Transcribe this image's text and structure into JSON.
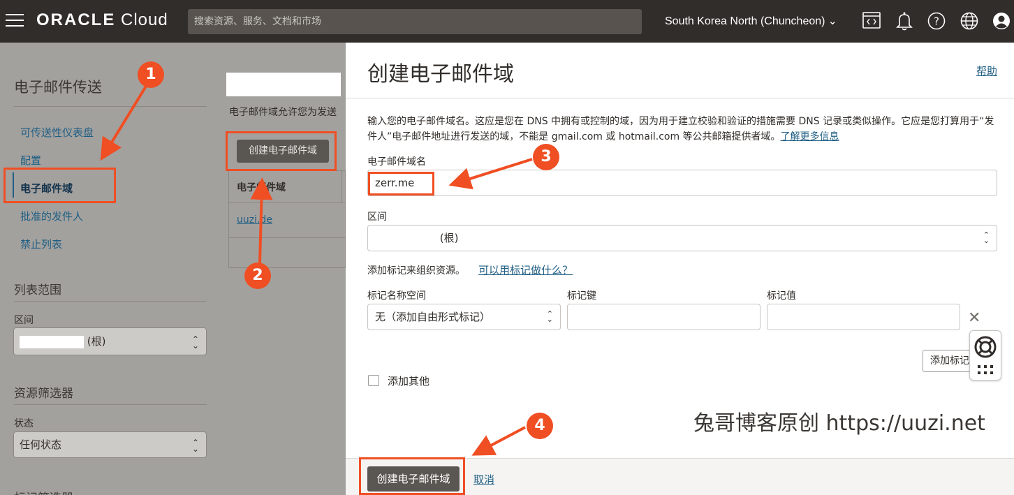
{
  "topbar": {
    "logo_brand": "ORACLE",
    "logo_product": "Cloud",
    "search_placeholder": "搜索资源、服务、文档和市场",
    "region": "South Korea North (Chuncheon)",
    "icons": [
      "hamburger-icon",
      "cloud-shell-icon",
      "bell-icon",
      "help-icon",
      "globe-icon",
      "user-icon"
    ]
  },
  "leftnav": {
    "title": "电子邮件传送",
    "items": [
      {
        "label": "可传送性仪表盘"
      },
      {
        "label": "配置"
      },
      {
        "label": "电子邮件域",
        "active": true
      },
      {
        "label": "批准的发件人"
      },
      {
        "label": "禁止列表"
      }
    ],
    "scope_title": "列表范围",
    "compartment_label": "区间",
    "compartment_value": "(根)",
    "filters_title": "资源筛选器",
    "state_label": "状态",
    "state_value": "任何状态",
    "tag_filters_title": "标记筛选器"
  },
  "middle": {
    "desc": "电子邮件域允许您为发送",
    "create_button": "创建电子邮件域",
    "column_header": "电子邮件域",
    "row_link": "uuzi.de"
  },
  "panel": {
    "title": "创建电子邮件域",
    "help": "帮助",
    "intro": "输入您的电子邮件域名。这应是您在 DNS 中拥有或控制的域，因为用于建立校验和验证的措施需要 DNS 记录或类似操作。它应是您打算用于“发件人”电子邮件地址进行发送的域，不能是 gmail.com 或 hotmail.com 等公共邮箱提供者域。",
    "intro_link": "了解更多信息",
    "domain_label": "电子邮件域名",
    "domain_value": "zerr.me",
    "compartment_label": "区间",
    "compartment_value": "(根)",
    "tags_intro": "添加标记来组织资源。",
    "tags_link": "可以用标记做什么？",
    "tag_ns_label": "标记名称空间",
    "tag_ns_value": "无（添加自由形式标记）",
    "tag_key_label": "标记键",
    "tag_value_label": "标记值",
    "add_tag_button": "添加标记",
    "add_other_label": "添加其他",
    "watermark": "兔哥博客原创 https://uuzi.net",
    "submit_button": "创建电子邮件域",
    "cancel": "取消"
  },
  "annotations": [
    "1",
    "2",
    "3",
    "4"
  ],
  "colors": {
    "accent": "#f04e23",
    "link": "#205f84",
    "topbar": "#312d2a"
  }
}
